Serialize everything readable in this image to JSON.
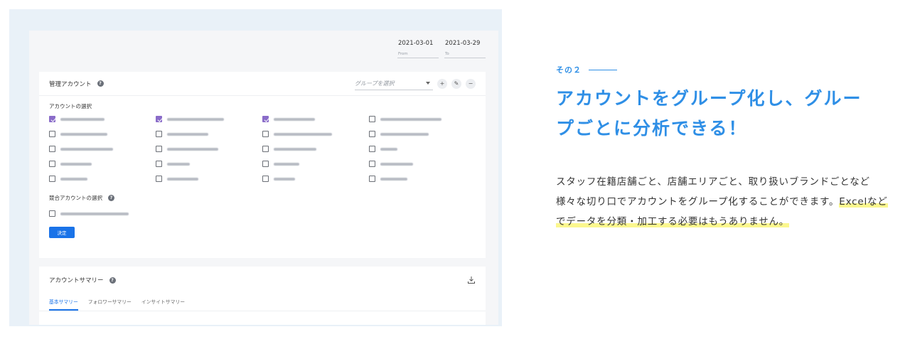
{
  "dates": {
    "from_value": "2021-03-01",
    "from_label": "From",
    "to_value": "2021-03-29",
    "to_label": "To"
  },
  "managed": {
    "title": "管理アカウント",
    "help": "?",
    "group_placeholder": "グループを選択",
    "add": "+",
    "edit": "✎",
    "remove": "−",
    "select_label": "アカウントの選択",
    "accounts": [
      {
        "checked": true,
        "w": 62
      },
      {
        "checked": true,
        "w": 80
      },
      {
        "checked": true,
        "w": 58
      },
      {
        "checked": false,
        "w": 86
      },
      {
        "checked": false,
        "w": 66
      },
      {
        "checked": false,
        "w": 58
      },
      {
        "checked": false,
        "w": 82
      },
      {
        "checked": false,
        "w": 68
      },
      {
        "checked": false,
        "w": 74
      },
      {
        "checked": false,
        "w": 72
      },
      {
        "checked": false,
        "w": 60
      },
      {
        "checked": false,
        "w": 24
      },
      {
        "checked": false,
        "w": 44
      },
      {
        "checked": false,
        "w": 32
      },
      {
        "checked": false,
        "w": 36
      },
      {
        "checked": false,
        "w": 46
      },
      {
        "checked": false,
        "w": 38
      },
      {
        "checked": false,
        "w": 44
      },
      {
        "checked": false,
        "w": 30
      },
      {
        "checked": false,
        "w": 38
      }
    ],
    "competitor_label": "競合アカウントの選択",
    "competitor_help": "?",
    "decide": "決定"
  },
  "summary": {
    "title": "アカウントサマリー",
    "help": "?",
    "tabs": [
      "基本サマリー",
      "フォロワーサマリー",
      "インサイトサマリー"
    ]
  },
  "right": {
    "kicker": "その２",
    "headline_1": "アカウントをグループ化し、グルー",
    "headline_2": "プごとに分析できる！",
    "body_1": "スタッフ在籍店舗ごと、店舗エリアごと、取り扱いブランドごとなど様々な切り口でアカウントをグループ化することができます。",
    "body_hl": "Excelなどでデータを分類・加工する必要はもうありません。"
  },
  "colors": {
    "accent": "#2f8fe6",
    "primary_button": "#1a73e8",
    "checkbox_checked": "#8a6cc9",
    "highlight": "#fbf78e"
  }
}
